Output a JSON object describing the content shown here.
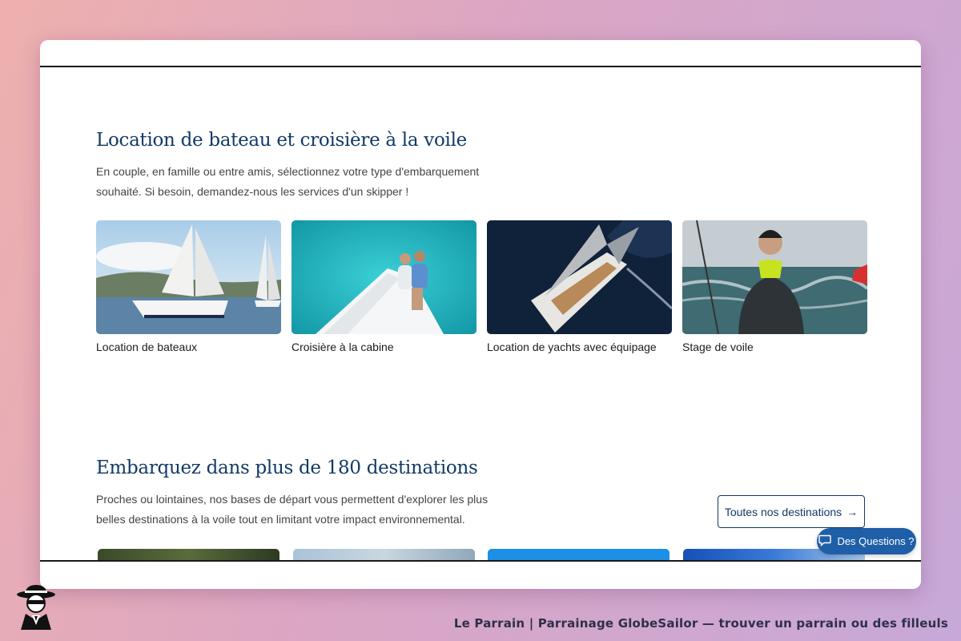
{
  "section1": {
    "title": "Location de bateau et croisière à la voile",
    "subtitle_line1": "En couple, en famille ou entre amis, sélectionnez votre type d'embarquement",
    "subtitle_line2": "souhaité. Si besoin, demandez-nous les services d'un skipper !",
    "tiles": [
      {
        "label": "Location de bateaux"
      },
      {
        "label": "Croisière à la cabine"
      },
      {
        "label": "Location de yachts avec équipage"
      },
      {
        "label": "Stage de voile"
      }
    ]
  },
  "section2": {
    "title": "Embarquez dans plus de 180 destinations",
    "subtitle_line1": "Proches ou lointaines, nos bases de départ vous permettent d'explorer les plus",
    "subtitle_line2": "belles destinations à la voile tout en limitant votre impact environnemental.",
    "button_label": "Toutes nos destinations"
  },
  "chat": {
    "label": "Des Questions ?",
    "icon": "chat-bubble-icon"
  },
  "footer": {
    "caption": "Le Parrain | Parrainage GlobeSailor — trouver un parrain ou des filleuls"
  },
  "colors": {
    "heading": "#123a66",
    "accent": "#1f5fa8"
  }
}
